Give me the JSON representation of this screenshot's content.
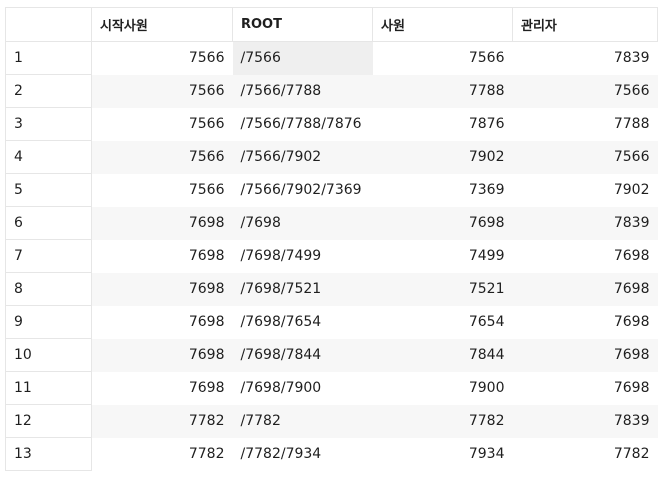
{
  "table": {
    "headers": [
      "",
      "시작사원",
      "ROOT",
      "사원",
      "관리자"
    ],
    "rows": [
      {
        "num": "1",
        "start": "7566",
        "root": "/7566",
        "emp": "7566",
        "mgr": "7839"
      },
      {
        "num": "2",
        "start": "7566",
        "root": "/7566/7788",
        "emp": "7788",
        "mgr": "7566"
      },
      {
        "num": "3",
        "start": "7566",
        "root": "/7566/7788/7876",
        "emp": "7876",
        "mgr": "7788"
      },
      {
        "num": "4",
        "start": "7566",
        "root": "/7566/7902",
        "emp": "7902",
        "mgr": "7566"
      },
      {
        "num": "5",
        "start": "7566",
        "root": "/7566/7902/7369",
        "emp": "7369",
        "mgr": "7902"
      },
      {
        "num": "6",
        "start": "7698",
        "root": "/7698",
        "emp": "7698",
        "mgr": "7839"
      },
      {
        "num": "7",
        "start": "7698",
        "root": "/7698/7499",
        "emp": "7499",
        "mgr": "7698"
      },
      {
        "num": "8",
        "start": "7698",
        "root": "/7698/7521",
        "emp": "7521",
        "mgr": "7698"
      },
      {
        "num": "9",
        "start": "7698",
        "root": "/7698/7654",
        "emp": "7654",
        "mgr": "7698"
      },
      {
        "num": "10",
        "start": "7698",
        "root": "/7698/7844",
        "emp": "7844",
        "mgr": "7698"
      },
      {
        "num": "11",
        "start": "7698",
        "root": "/7698/7900",
        "emp": "7900",
        "mgr": "7698"
      },
      {
        "num": "12",
        "start": "7782",
        "root": "/7782",
        "emp": "7782",
        "mgr": "7839"
      },
      {
        "num": "13",
        "start": "7782",
        "root": "/7782/7934",
        "emp": "7934",
        "mgr": "7782"
      }
    ]
  }
}
